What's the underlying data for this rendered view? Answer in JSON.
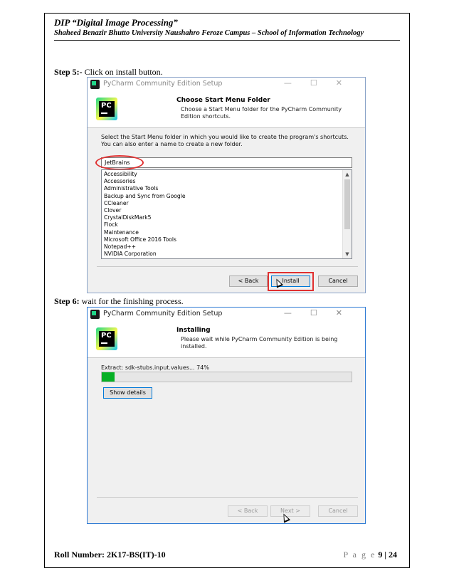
{
  "header": {
    "course": "DIP “Digital Image Processing”",
    "institution": "Shaheed Benazir Bhutto University Naushahro Feroze Campus – School of Information Technology"
  },
  "step5": {
    "label": "Step 5:-",
    "text": " Click on install button."
  },
  "step6": {
    "label": "Step 6:",
    "text": " wait for the finishing process."
  },
  "dialog1": {
    "title": "PyCharm Community Edition Setup",
    "heading": "Choose Start Menu Folder",
    "subheading": "Choose a Start Menu folder for the PyCharm Community Edition shortcuts.",
    "instructions": "Select the Start Menu folder in which you would like to create the program's shortcuts. You can also enter a name to create a new folder.",
    "folder_value": "JetBrains",
    "folders": [
      "Accessibility",
      "Accessories",
      "Administrative Tools",
      "Backup and Sync from Google",
      "CCleaner",
      "Clover",
      "CrystalDiskMark5",
      "Flock",
      "Maintenance",
      "Microsoft Office 2016 Tools",
      "Notepad++",
      "NVIDIA Corporation"
    ],
    "back_label": "< Back",
    "install_label": "Install",
    "cancel_label": "Cancel",
    "logo_text": "PC"
  },
  "dialog2": {
    "title": "PyCharm Community Edition Setup",
    "heading": "Installing",
    "subheading": "Please wait while PyCharm Community Edition is being installed.",
    "status": "Extract: sdk-stubs.input.values... 74%",
    "progress_fraction": 0.05,
    "show_details_label": "Show details",
    "back_label": "< Back",
    "next_label": "Next >",
    "cancel_label": "Cancel",
    "logo_text": "PC"
  },
  "footer": {
    "roll": "Roll Number: 2K17-BS(IT)-10",
    "page_word": "P a g e",
    "page_num": "9",
    "page_sep": " | ",
    "page_total": "24"
  },
  "colors": {
    "accent_red": "#e03030",
    "progress_green": "#06b025",
    "focus_blue": "#0078d7"
  }
}
